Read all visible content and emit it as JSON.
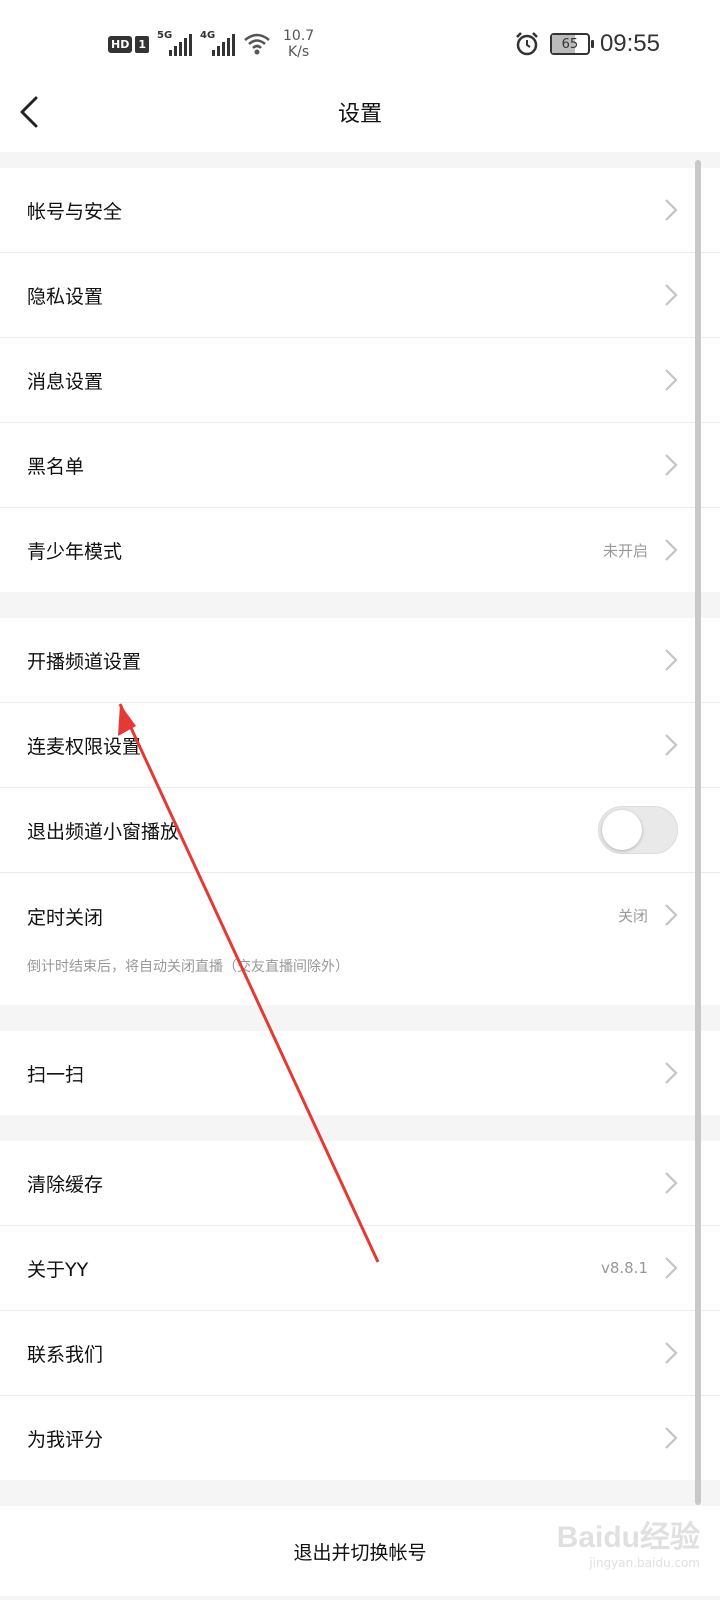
{
  "statusbar": {
    "hd": "HD",
    "sim": "1",
    "sig1_gen": "5G",
    "sig2_gen": "4G",
    "net_speed_value": "10.7",
    "net_speed_unit": "K/s",
    "battery": "65",
    "battery_level": 0.65,
    "time": "09:55"
  },
  "nav": {
    "title": "设置"
  },
  "groups": {
    "g1": {
      "account": "帐号与安全",
      "privacy": "隐私设置",
      "message": "消息设置",
      "blacklist": "黑名单",
      "teen": "青少年模式",
      "teen_value": "未开启"
    },
    "g2": {
      "channel": "开播频道设置",
      "mic": "连麦权限设置",
      "miniwin": "退出频道小窗播放",
      "miniwin_on": false,
      "timer": "定时关闭",
      "timer_value": "关闭",
      "timer_hint": "倒计时结束后，将自动关闭直播（交友直播间除外）"
    },
    "g3": {
      "scan": "扫一扫"
    },
    "g4": {
      "cache": "清除缓存",
      "about": "关于YY",
      "about_value": "v8.8.1",
      "contact": "联系我们",
      "rate": "为我评分"
    }
  },
  "logout": "退出并切换帐号",
  "watermark": {
    "logo": "Baidu经验",
    "url": "jingyan.baidu.com"
  }
}
